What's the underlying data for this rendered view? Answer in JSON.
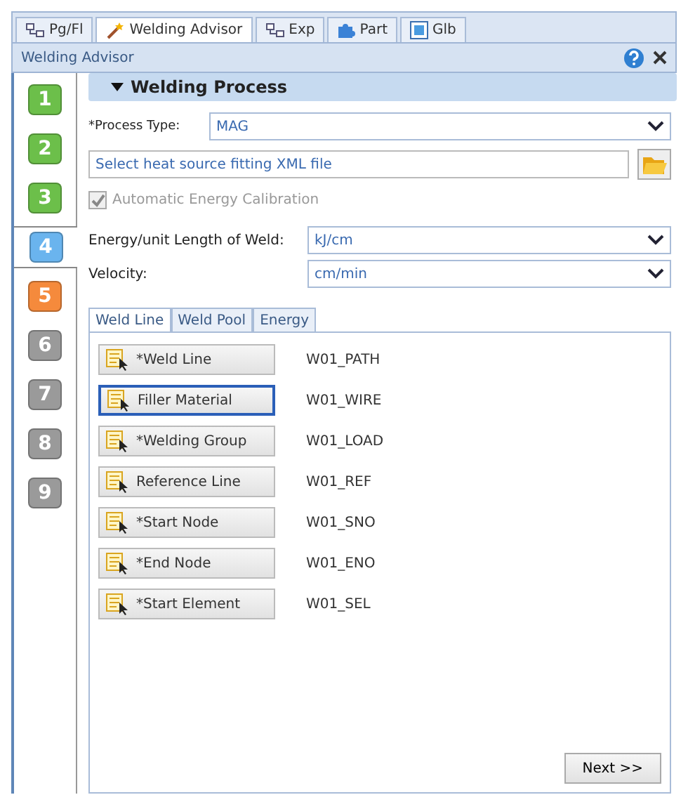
{
  "top_tabs": [
    {
      "label": "Pg/Fl",
      "kind": "tree",
      "selected": false
    },
    {
      "label": "Welding Advisor",
      "kind": "wand",
      "selected": true
    },
    {
      "label": "Exp",
      "kind": "tree",
      "selected": false
    },
    {
      "label": "Part",
      "kind": "puzzle",
      "selected": false
    },
    {
      "label": "Glb",
      "kind": "window",
      "selected": false
    }
  ],
  "panel_title": "Welding Advisor",
  "steps": [
    {
      "label": "1",
      "color": "#6cbf4a",
      "selected": false
    },
    {
      "label": "2",
      "color": "#6cbf4a",
      "selected": false
    },
    {
      "label": "3",
      "color": "#6cbf4a",
      "selected": false
    },
    {
      "label": "4",
      "color": "#6ab4ee",
      "selected": true
    },
    {
      "label": "5",
      "color": "#f58a3c",
      "selected": false
    },
    {
      "label": "6",
      "color": "#9a9a9a",
      "selected": false
    },
    {
      "label": "7",
      "color": "#9a9a9a",
      "selected": false
    },
    {
      "label": "8",
      "color": "#9a9a9a",
      "selected": false
    },
    {
      "label": "9",
      "color": "#9a9a9a",
      "selected": false
    }
  ],
  "section_title": "Welding Process",
  "process_type": {
    "label": "*Process Type:",
    "value": "MAG"
  },
  "heat_source": {
    "placeholder": "Select heat source fitting XML file"
  },
  "auto_calibration": {
    "label": "Automatic Energy Calibration",
    "checked": true,
    "disabled": true
  },
  "energy": {
    "label": "Energy/unit Length of Weld:",
    "value": "kJ/cm"
  },
  "velocity": {
    "label": "Velocity:",
    "value": "cm/min"
  },
  "inner_tabs": [
    {
      "label": "Weld Line",
      "selected": true
    },
    {
      "label": "Weld Pool",
      "selected": false
    },
    {
      "label": "Energy",
      "selected": false
    }
  ],
  "selectors": [
    {
      "label": "*Weld Line",
      "value": "W01_PATH",
      "focused": false
    },
    {
      "label": "Filler Material",
      "value": "W01_WIRE",
      "focused": true
    },
    {
      "label": "*Welding Group",
      "value": "W01_LOAD",
      "focused": false
    },
    {
      "label": "Reference Line",
      "value": "W01_REF",
      "focused": false
    },
    {
      "label": "*Start Node",
      "value": "W01_SNO",
      "focused": false
    },
    {
      "label": "*End Node",
      "value": "W01_ENO",
      "focused": false
    },
    {
      "label": "*Start Element",
      "value": "W01_SEL",
      "focused": false
    }
  ],
  "next_button": "Next >>"
}
